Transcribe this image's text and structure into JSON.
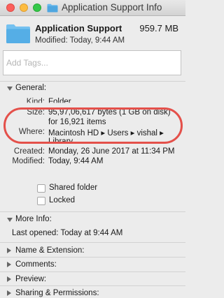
{
  "window": {
    "title": "Application Support Info"
  },
  "header": {
    "name": "Application Support",
    "size": "959.7 MB",
    "modified": "Modified: Today, 9:44 AM"
  },
  "tags": {
    "placeholder": "Add Tags..."
  },
  "general": {
    "heading": "General:",
    "kind_label": "Kind:",
    "kind_value": "Folder",
    "size_label": "Size:",
    "size_value": "95,97,06,617 bytes (1 GB on disk)",
    "size_items": "for 16,921 items",
    "where_label": "Where:",
    "where_value": "Macintosh HD ▸ Users ▸ vishal ▸",
    "where_cont": "Library",
    "created_label": "Created:",
    "created_value": "Monday, 26 June 2017 at 11:34 PM",
    "modified_label": "Modified:",
    "modified_value": "Today, 9:44 AM",
    "shared_label": "Shared folder",
    "locked_label": "Locked"
  },
  "more_info": {
    "heading": "More Info:",
    "last_opened": "Last opened: Today at 9:44 AM"
  },
  "collapsed_sections": [
    "Name & Extension:",
    "Comments:",
    "Preview:",
    "Sharing & Permissions:"
  ],
  "colors": {
    "annotation": "#e4504a",
    "folder": "#5fb5ea"
  },
  "icons": {
    "title": "folder-icon",
    "header": "folder-icon"
  }
}
